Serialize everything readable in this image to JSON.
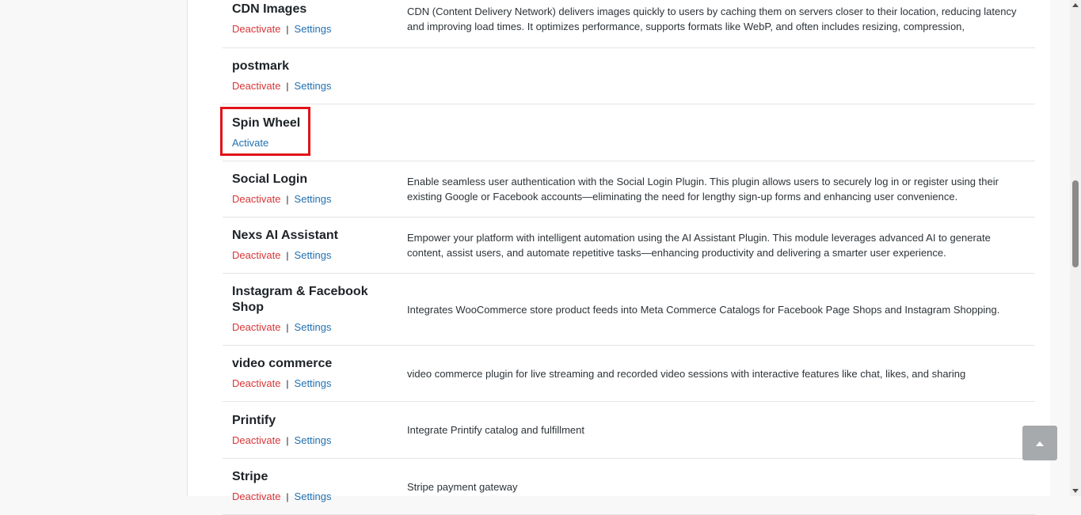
{
  "plugins": [
    {
      "name": "CDN Images",
      "deactivate_label": "Deactivate",
      "settings_label": "Settings",
      "description": "CDN (Content Delivery Network) delivers images quickly to users by caching them on servers closer to their location, reducing latency and improving load times. It optimizes performance, supports formats like WebP, and often includes resizing, compression,"
    },
    {
      "name": "postmark",
      "deactivate_label": "Deactivate",
      "settings_label": "Settings",
      "description": ""
    },
    {
      "name": "Spin Wheel",
      "activate_label": "Activate",
      "description": ""
    },
    {
      "name": "Social Login",
      "deactivate_label": "Deactivate",
      "settings_label": "Settings",
      "description": "Enable seamless user authentication with the Social Login Plugin. This plugin allows users to securely log in or register using their existing Google or Facebook accounts—eliminating the need for lengthy sign-up forms and enhancing user convenience."
    },
    {
      "name": "Nexs AI Assistant",
      "deactivate_label": "Deactivate",
      "settings_label": "Settings",
      "description": "Empower your platform with intelligent automation using the AI Assistant Plugin. This module leverages advanced AI to generate content, assist users, and automate repetitive tasks—enhancing productivity and delivering a smarter user experience."
    },
    {
      "name": "Instagram & Facebook Shop",
      "deactivate_label": "Deactivate",
      "settings_label": "Settings",
      "description": "Integrates WooCommerce store product feeds into Meta Commerce Catalogs for Facebook Page Shops and Instagram Shopping."
    },
    {
      "name": "video commerce",
      "deactivate_label": "Deactivate",
      "settings_label": "Settings",
      "description": "video commerce plugin for live streaming and recorded video sessions with interactive features like chat, likes, and sharing"
    },
    {
      "name": "Printify",
      "deactivate_label": "Deactivate",
      "settings_label": "Settings",
      "description": "Integrate Printify catalog and fulfillment"
    },
    {
      "name": "Stripe",
      "deactivate_label": "Deactivate",
      "settings_label": "Settings",
      "description": "Stripe payment gateway"
    }
  ],
  "separator": "|",
  "icons": {
    "scroll_top": "chevron-up-icon"
  },
  "colors": {
    "deactivate": "#d63638",
    "link": "#2271b1",
    "highlight": "#e0141a"
  }
}
